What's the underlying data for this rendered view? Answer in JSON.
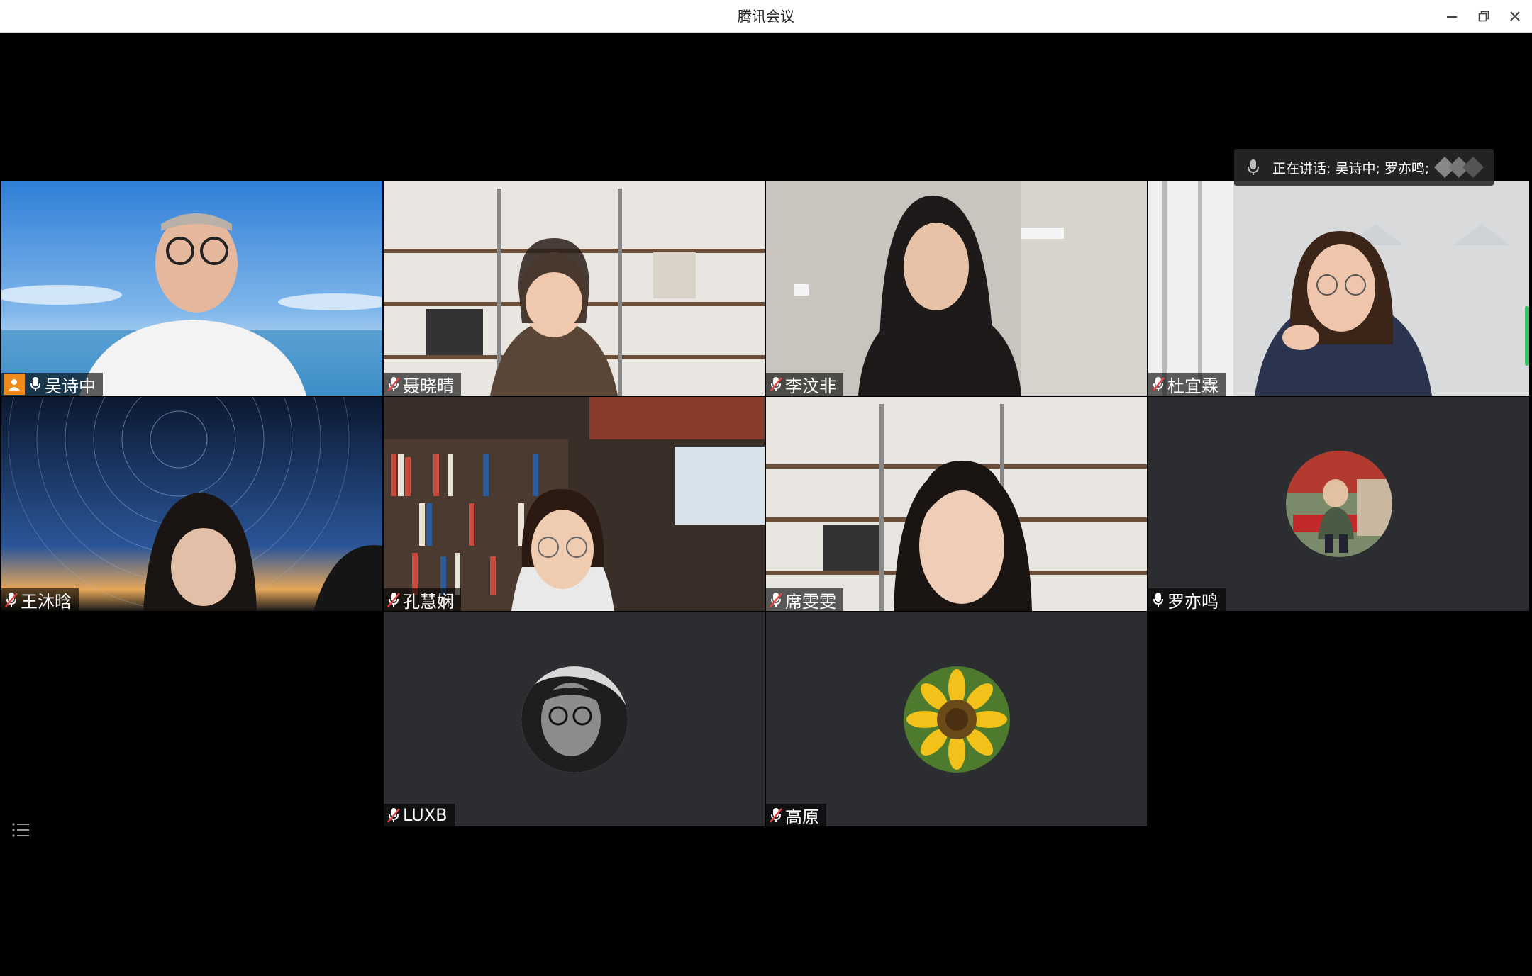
{
  "window": {
    "title": "腾讯会议",
    "controls": [
      "minimize-icon",
      "restore-icon",
      "close-icon"
    ]
  },
  "speaking_indicator": {
    "label": "正在讲话: 吴诗中; 罗亦鸣;"
  },
  "participants": [
    {
      "name": "吴诗中",
      "is_host": true,
      "mic": "on",
      "scene": "sky-sea-background",
      "active_speaker": true
    },
    {
      "name": "聂晓晴",
      "mic": "muted",
      "scene": "bookshelf-background"
    },
    {
      "name": "李汶非",
      "mic": "muted",
      "scene": "room-wall"
    },
    {
      "name": "杜宜霖",
      "mic": "muted",
      "scene": "kitchen-room"
    },
    {
      "name": "王沐晗",
      "mic": "muted",
      "scene": "star-trail-background"
    },
    {
      "name": "孔慧娴",
      "mic": "muted",
      "scene": "library-brick-background"
    },
    {
      "name": "席雯雯",
      "mic": "muted",
      "scene": "bookshelf-background"
    },
    {
      "name": "罗亦鸣",
      "mic": "on",
      "scene": "camera-off-avatar-photo"
    },
    {
      "name": "LUXB",
      "mic": "muted",
      "scene": "camera-off-avatar-portrait"
    },
    {
      "name": "高原",
      "mic": "muted",
      "scene": "camera-off-avatar-sunflower"
    }
  ],
  "colors": {
    "host_badge": "#f08a1d",
    "active_border": "#1fa463",
    "muted_mic": "#e64545",
    "tile_bg": "#2b2d30"
  },
  "bottom_left_button": "participant-list-icon"
}
